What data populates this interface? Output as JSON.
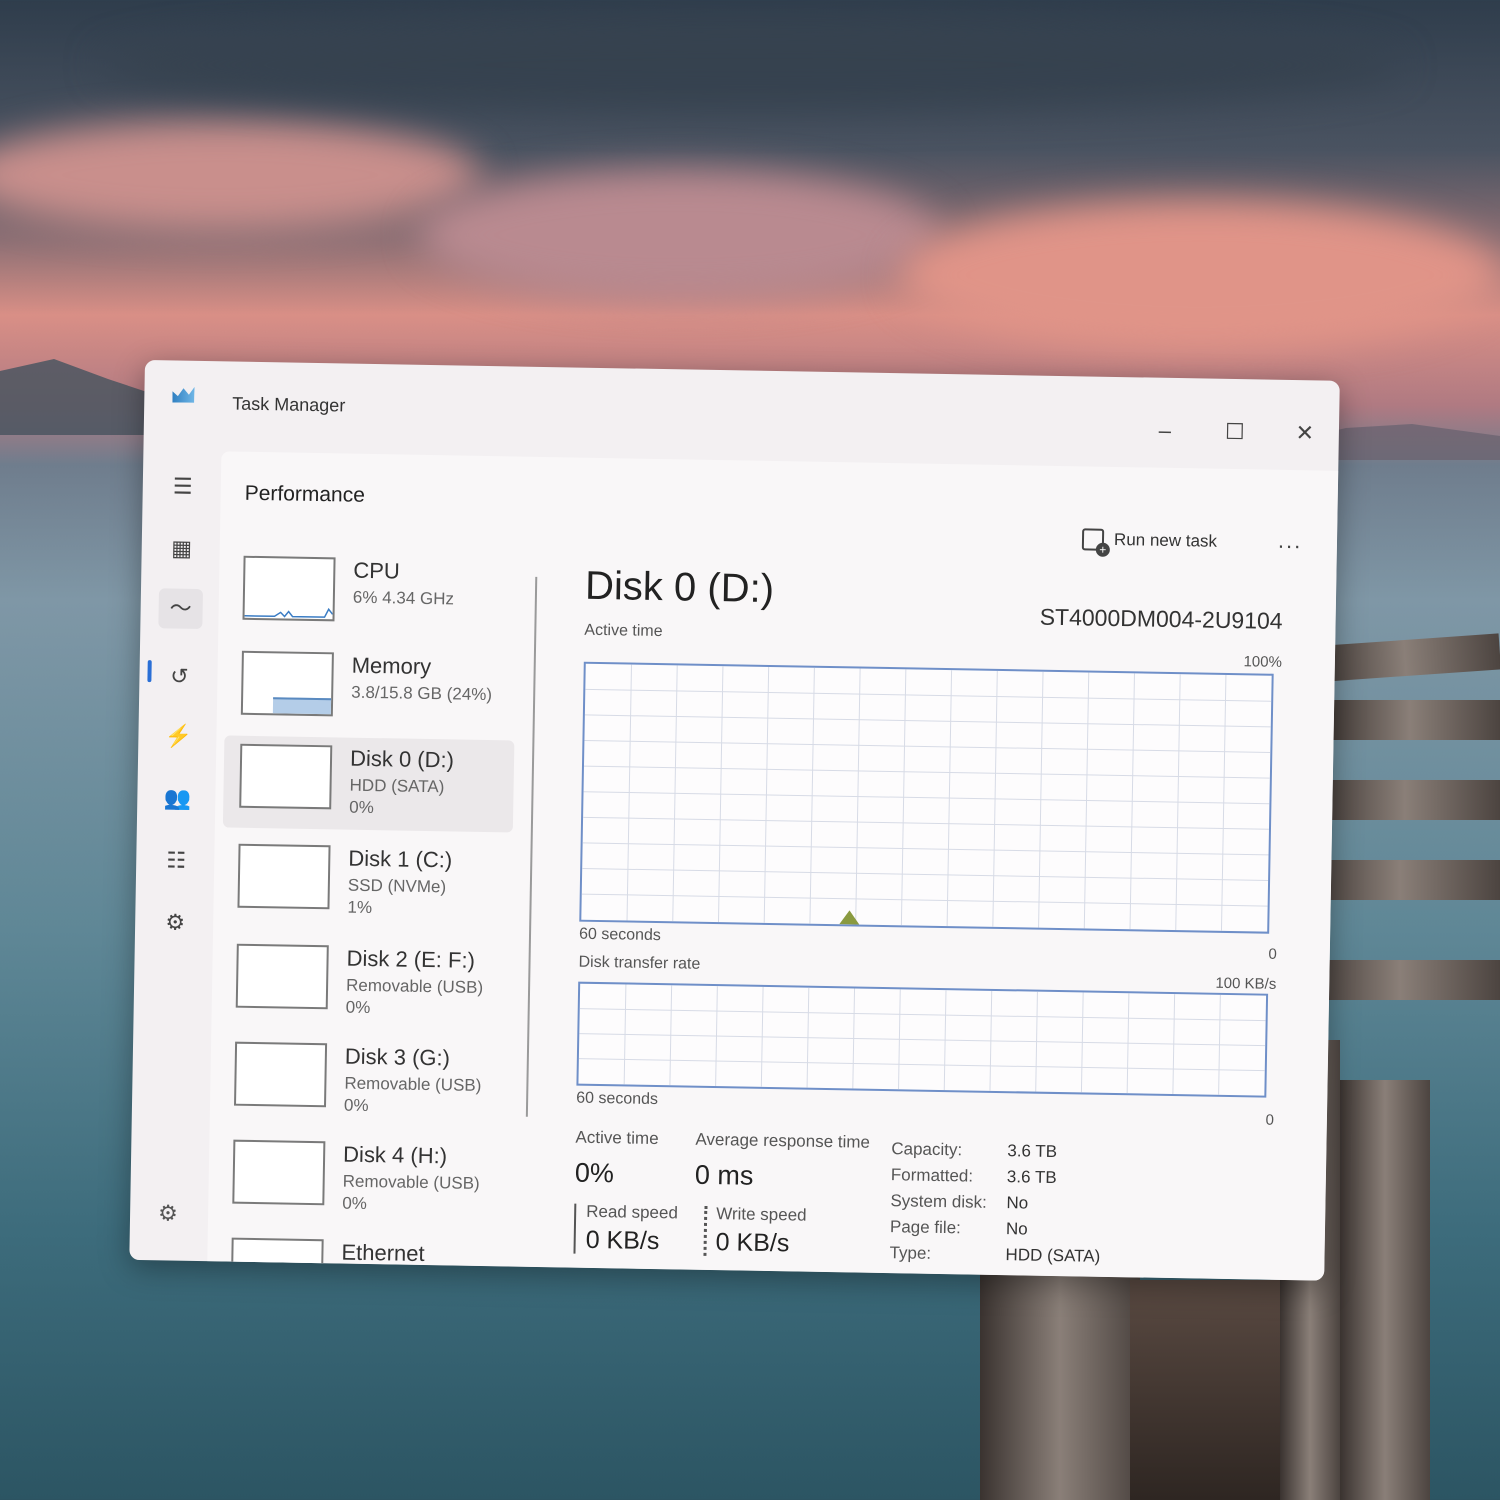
{
  "window": {
    "title": "Task Manager",
    "minimize_icon": "minimize-icon",
    "maximize_icon": "maximize-icon",
    "close_icon": "close-icon"
  },
  "header": {
    "page_title": "Performance",
    "run_new_task": "Run new task",
    "more": "..."
  },
  "sidebar": {
    "items": [
      {
        "name": "CPU",
        "sub": "6% 4.34 GHz",
        "sub2": ""
      },
      {
        "name": "Memory",
        "sub": "3.8/15.8 GB (24%)",
        "sub2": ""
      },
      {
        "name": "Disk 0 (D:)",
        "sub": "HDD (SATA)",
        "sub2": "0%"
      },
      {
        "name": "Disk 1 (C:)",
        "sub": "SSD (NVMe)",
        "sub2": "1%"
      },
      {
        "name": "Disk 2 (E: F:)",
        "sub": "Removable (USB)",
        "sub2": "0%"
      },
      {
        "name": "Disk 3 (G:)",
        "sub": "Removable (USB)",
        "sub2": "0%"
      },
      {
        "name": "Disk 4 (H:)",
        "sub": "Removable (USB)",
        "sub2": "0%"
      },
      {
        "name": "Ethernet",
        "sub": "",
        "sub2": ""
      }
    ]
  },
  "detail": {
    "title": "Disk 0 (D:)",
    "model": "ST4000DM004-2U9104",
    "active_time_graph": {
      "label": "Active time",
      "max": "100%",
      "min": "0",
      "duration": "60 seconds"
    },
    "transfer_graph": {
      "label": "Disk transfer rate",
      "max": "100 KB/s",
      "min": "0",
      "duration": "60 seconds"
    },
    "stats": {
      "active_time_label": "Active time",
      "active_time_value": "0%",
      "avg_response_label": "Average response time",
      "avg_response_value": "0 ms",
      "read_label": "Read speed",
      "read_value": "0 KB/s",
      "write_label": "Write speed",
      "write_value": "0 KB/s"
    },
    "info": [
      {
        "key": "Capacity:",
        "value": "3.6 TB"
      },
      {
        "key": "Formatted:",
        "value": "3.6 TB"
      },
      {
        "key": "System disk:",
        "value": "No"
      },
      {
        "key": "Page file:",
        "value": "No"
      },
      {
        "key": "Type:",
        "value": "HDD (SATA)"
      }
    ]
  },
  "colors": {
    "accent": "#2a6fd6",
    "graph_border": "#6f8fc8",
    "grid": "#d7dbe6"
  }
}
